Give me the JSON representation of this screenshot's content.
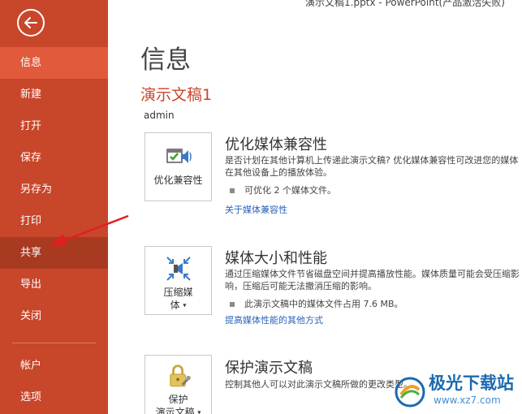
{
  "window": {
    "title": "演示文稿1.pptx - PowerPoint(产品激活失败)"
  },
  "sidebar": {
    "items": [
      {
        "label": "信息"
      },
      {
        "label": "新建"
      },
      {
        "label": "打开"
      },
      {
        "label": "保存"
      },
      {
        "label": "另存为"
      },
      {
        "label": "打印"
      },
      {
        "label": "共享"
      },
      {
        "label": "导出"
      },
      {
        "label": "关闭"
      },
      {
        "label": "帐户"
      },
      {
        "label": "选项"
      }
    ]
  },
  "main": {
    "page_title": "信息",
    "doc_name": "演示文稿1",
    "author": "admin",
    "sections": [
      {
        "button_label": "优化兼容性",
        "icon": "media-compat-icon",
        "title": "优化媒体兼容性",
        "desc": "是否计划在其他计算机上传递此演示文稿? 优化媒体兼容性可改进您的媒体在其他设备上的播放体验。",
        "bullet": "可优化 2 个媒体文件。",
        "link": "关于媒体兼容性"
      },
      {
        "button_label_line1": "压缩媒",
        "button_label_line2": "体",
        "icon": "compress-media-icon",
        "title": "媒体大小和性能",
        "desc": "通过压缩媒体文件节省磁盘空间并提高播放性能。媒体质量可能会受压缩影响，压缩后可能无法撤消压缩的影响。",
        "bullet": "此演示文稿中的媒体文件占用 7.6 MB。",
        "link": "提高媒体性能的其他方式"
      },
      {
        "button_label_line1": "保护",
        "button_label_line2": "演示文稿",
        "icon": "lock-key-icon",
        "title": "保护演示文稿",
        "desc": "控制其他人可以对此演示文稿所做的更改类型。"
      }
    ]
  },
  "watermark": {
    "text1": "极光下载站",
    "text2": "www.xz7.com"
  },
  "colors": {
    "sidebar": "#c8462a",
    "active": "#e05a3b",
    "link": "#2a63b8",
    "accent": "#c8462a"
  }
}
